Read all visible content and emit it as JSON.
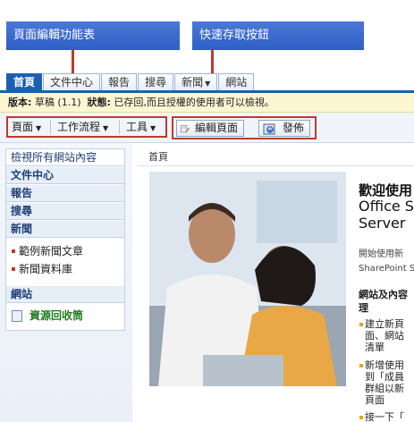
{
  "callouts": {
    "left": "頁面編輯功能表",
    "right": "快速存取按鈕"
  },
  "tabs": [
    {
      "label": "首頁",
      "active": true
    },
    {
      "label": "文件中心"
    },
    {
      "label": "報告"
    },
    {
      "label": "搜尋"
    },
    {
      "label": "新聞",
      "dropdown": true
    },
    {
      "label": "網站"
    }
  ],
  "status": {
    "version_label": "版本:",
    "version_value": "草稿 (1.1)",
    "state_label": "狀態:",
    "state_value": "已存回,而且授權的使用者可以檢視。"
  },
  "toolbar": {
    "page_menu": "頁面",
    "workflow_menu": "工作流程",
    "tools_menu": "工具",
    "edit_button": "編輯頁面",
    "publish_button": "發佈"
  },
  "leftnav": {
    "view_all": "檢視所有網站內容",
    "doc_center": "文件中心",
    "reports": "報告",
    "search": "搜尋",
    "news": "新聞",
    "news_items": [
      "範例新聞文章",
      "新聞資料庫"
    ],
    "sites": "網站",
    "recycle_bin": "資源回收筒"
  },
  "main": {
    "breadcrumb": "首頁",
    "welcome_title": "歡迎使用",
    "welcome_sub": "Office S\nServer",
    "intro": "開始使用新\nSharePoint S",
    "features_title": "網站及內容\n理",
    "features": [
      "建立新頁\n面、網站\n清單",
      "新增使用\n到「成員\n群組以新\n頁面",
      "接一下「"
    ]
  },
  "colors": {
    "callout_bg": "#3a6ad0",
    "highlight_border": "#c0392b",
    "tab_active": "#1c5fb0",
    "status_bg": "#fdf6d3",
    "recycle_text": "#1f7a1f"
  }
}
